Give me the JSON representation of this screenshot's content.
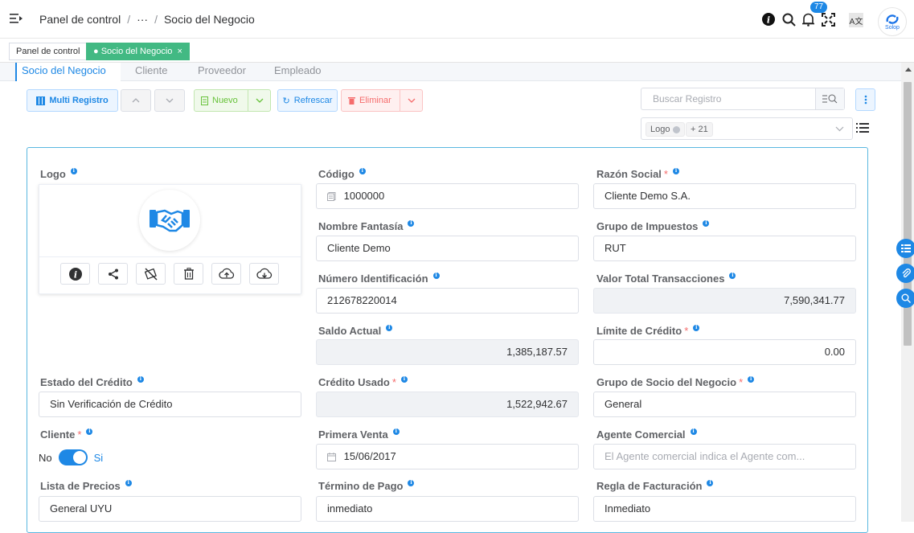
{
  "header": {
    "breadcrumb": [
      "Panel de control",
      "···",
      "Socio del Negocio"
    ],
    "notification_count": "77",
    "avatar_label": "Solop",
    "lang_label": "A文"
  },
  "tags": [
    {
      "label": "Panel de control",
      "active": false
    },
    {
      "label": "Socio del Negocio",
      "active": true
    }
  ],
  "subtabs": [
    "Socio del Negocio",
    "Cliente",
    "Proveedor",
    "Empleado"
  ],
  "toolbar": {
    "multi_label": "Multi Registro",
    "nuevo_label": "Nuevo",
    "refrescar_label": "Refrescar",
    "eliminar_label": "Eliminar",
    "search_placeholder": "Buscar Registro",
    "chip_logo": "Logo",
    "chip_more": "+ 21"
  },
  "form": {
    "logo_label": "Logo",
    "codigo": {
      "label": "Código",
      "value": "1000000"
    },
    "razon_social": {
      "label": "Razón Social",
      "value": "Cliente Demo S.A."
    },
    "nombre_fantasia": {
      "label": "Nombre Fantasía",
      "value": "Cliente Demo"
    },
    "grupo_impuestos": {
      "label": "Grupo de Impuestos",
      "value": "RUT"
    },
    "numero_identificacion": {
      "label": "Número Identificación",
      "value": "212678220014"
    },
    "valor_total": {
      "label": "Valor Total Transacciones",
      "value": "7,590,341.77"
    },
    "saldo_actual": {
      "label": "Saldo Actual",
      "value": "1,385,187.57"
    },
    "limite_credito": {
      "label": "Límite de Crédito",
      "value": "0.00"
    },
    "estado_credito": {
      "label": "Estado del Crédito",
      "value": "Sin Verificación de Crédito"
    },
    "credito_usado": {
      "label": "Crédito Usado",
      "value": "1,522,942.67"
    },
    "grupo_socio": {
      "label": "Grupo de Socio del Negocio",
      "value": "General"
    },
    "cliente": {
      "label": "Cliente",
      "off_label": "No",
      "on_label": "Si"
    },
    "primera_venta": {
      "label": "Primera Venta",
      "value": "15/06/2017"
    },
    "agente_comercial": {
      "label": "Agente Comercial",
      "placeholder": "El Agente comercial indica el Agente com..."
    },
    "lista_precios": {
      "label": "Lista de Precios",
      "value": "General UYU"
    },
    "termino_pago": {
      "label": "Término de Pago",
      "value": "inmediato"
    },
    "regla_facturacion": {
      "label": "Regla de Facturación",
      "value": "Inmediato"
    }
  },
  "colors": {
    "primary": "#1e88e5",
    "success": "#42b983",
    "danger": "#f56c6c",
    "card_border": "#5ab7e0"
  }
}
